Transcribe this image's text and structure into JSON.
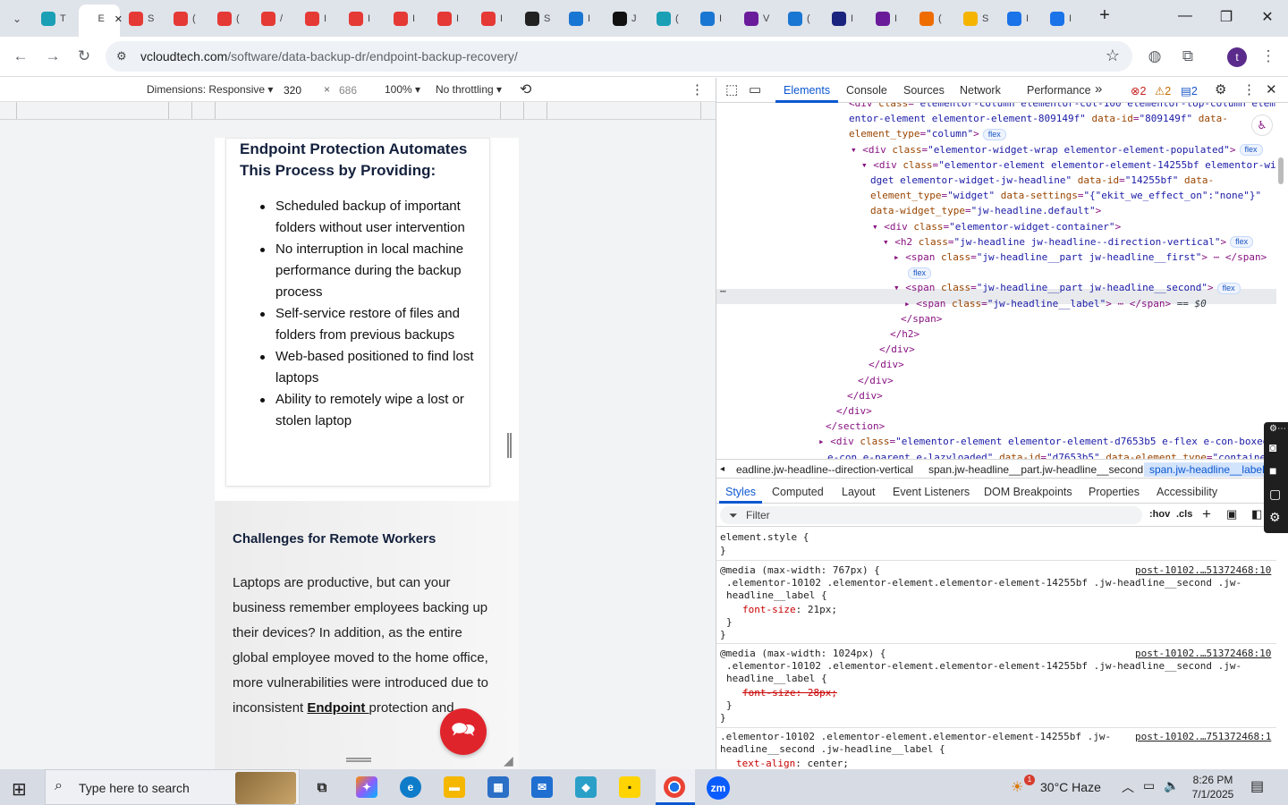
{
  "browser": {
    "tabs": [
      {
        "icon": "tab-favicon-teal",
        "label": "T"
      },
      {
        "icon": "tab-favicon-active",
        "label": "E"
      },
      {
        "icon": "tab-favicon-red",
        "label": "S"
      },
      {
        "icon": "tab-favicon-red",
        "label": "("
      },
      {
        "icon": "tab-favicon-red",
        "label": "("
      },
      {
        "icon": "tab-favicon-red",
        "label": "/"
      },
      {
        "icon": "tab-favicon-red",
        "label": "I"
      },
      {
        "icon": "tab-favicon-red",
        "label": "I"
      },
      {
        "icon": "tab-favicon-red",
        "label": "I"
      },
      {
        "icon": "tab-favicon-red",
        "label": "I"
      },
      {
        "icon": "tab-favicon-red",
        "label": "I"
      },
      {
        "icon": "tab-favicon-dark",
        "label": "S"
      },
      {
        "icon": "tab-favicon-blue",
        "label": "I"
      },
      {
        "icon": "tab-favicon-black",
        "label": "J"
      },
      {
        "icon": "tab-favicon-teal",
        "label": "("
      },
      {
        "icon": "tab-favicon-blue",
        "label": "I"
      },
      {
        "icon": "tab-favicon-purple",
        "label": "V"
      },
      {
        "icon": "tab-favicon-blue",
        "label": "("
      },
      {
        "icon": "tab-favicon-navy",
        "label": "I"
      },
      {
        "icon": "tab-favicon-purple",
        "label": "I"
      },
      {
        "icon": "tab-favicon-orange",
        "label": "("
      },
      {
        "icon": "tab-favicon-multicolor",
        "label": "S"
      },
      {
        "icon": "tab-favicon-docs",
        "label": "I"
      },
      {
        "icon": "tab-favicon-docs",
        "label": "I"
      }
    ],
    "active_tab_label": "E",
    "new_tab": "+",
    "url_host": "vcloudtech.com",
    "url_path": "/software/data-backup-dr/endpoint-backup-recovery/",
    "profile_initial": "t"
  },
  "device_toolbar": {
    "dimensions_label": "Dimensions: Responsive",
    "width": "320",
    "times": "×",
    "height": "686",
    "zoom": "100%",
    "throttling": "No throttling"
  },
  "page": {
    "card_heading": "Endpoint Protection Automates This Process by Providing:",
    "bullets": [
      "Scheduled backup of important folders without user intervention",
      "No interruption in local machine performance during the backup process",
      "Self-service restore of files and folders from previous backups",
      "Web-based positioned to find lost laptops",
      "Ability to remotely wipe a lost or stolen laptop"
    ],
    "section_title": "Challenges for Remote Workers",
    "body_before_link": "Laptops are productive, but can your business remember employees backing up their devices? In addition, as the entire global employee moved to the home office, more vulnerabilities were introduced due to inconsistent ",
    "body_link": "Endpoint ",
    "body_after_link": "protection and"
  },
  "devtools": {
    "tabs": [
      "Elements",
      "Console",
      "Sources",
      "Network",
      "Performance"
    ],
    "more_tabs": "»",
    "errors": "2",
    "warnings": "2",
    "messages": "2",
    "dom_lines": [
      {
        "indent": 148,
        "html": "<span class='tg'>&lt;div</span> <span class='at'>class</span>=<span class='av'>\"elementor-column elementor-col-100 elementor-top-column elem</span>"
      },
      {
        "indent": 148,
        "html": "<span class='av'>entor-element elementor-element-809149f\"</span> <span class='at'>data-id</span>=<span class='av'>\"809149f\"</span> <span class='at'>data-</span>"
      },
      {
        "indent": 148,
        "html": "<span class='at'>element_type</span>=<span class='av'>\"column\"</span><span class='tg'>&gt;</span>"
      },
      {
        "indent": 150,
        "html": "▾ <span class='tg'>&lt;div</span> <span class='at'>class</span>=<span class='av'>\"elementor-widget-wrap elementor-element-populated\"</span><span class='tg'>&gt;</span>"
      },
      {
        "indent": 162,
        "html": "▾ <span class='tg'>&lt;div</span> <span class='at'>class</span>=<span class='av'>\"elementor-element elementor-element-14255bf elementor-wi</span>"
      },
      {
        "indent": 172,
        "html": "<span class='av'>dget elementor-widget-jw-headline\"</span> <span class='at'>data-id</span>=<span class='av'>\"14255bf\"</span> <span class='at'>data-</span>"
      },
      {
        "indent": 172,
        "html": "<span class='at'>element_type</span>=<span class='av'>\"widget\"</span> <span class='at'>data-settings</span>=<span class='av'>\"{\"ekit_we_effect_on\":\"none\"}\"</span>"
      },
      {
        "indent": 172,
        "html": "<span class='at'>data-widget_type</span>=<span class='av'>\"jw-headline.default\"</span><span class='tg'>&gt;</span>"
      },
      {
        "indent": 174,
        "html": "▾ <span class='tg'>&lt;div</span> <span class='at'>class</span>=<span class='av'>\"elementor-widget-container\"</span><span class='tg'>&gt;</span>"
      },
      {
        "indent": 186,
        "html": "▾ <span class='tg'>&lt;h2</span> <span class='at'>class</span>=<span class='av'>\"jw-headline jw-headline--direction-vertical\"</span><span class='tg'>&gt;</span>"
      },
      {
        "indent": 198,
        "html": "▸ <span class='tg'>&lt;span</span> <span class='at'>class</span>=<span class='av'>\"jw-headline__part jw-headline__first\"</span><span class='tg'>&gt;</span> ⋯ <span class='tg'>&lt;/span&gt;</span>"
      },
      {
        "indent": 210,
        "html": ""
      },
      {
        "indent": 198,
        "html": "▾ <span class='tg'>&lt;span</span> <span class='at'>class</span>=<span class='av'>\"jw-headline__part jw-headline__second\"</span><span class='tg'>&gt;</span>"
      },
      {
        "indent": 210,
        "html": "▸ <span class='tg'>&lt;span</span> <span class='at'>class</span>=<span class='av'>\"jw-headline__label\"</span><span class='tg'>&gt;</span> ⋯ <span class='tg'>&lt;/span&gt;</span> <span class='tx'><i>== $0</i></span>"
      },
      {
        "indent": 206,
        "html": "<span class='tg'>&lt;/span&gt;</span>"
      },
      {
        "indent": 194,
        "html": "<span class='tg'>&lt;/h2&gt;</span>"
      },
      {
        "indent": 182,
        "html": "<span class='tg'>&lt;/div&gt;</span>"
      },
      {
        "indent": 170,
        "html": "<span class='tg'>&lt;/div&gt;</span>"
      },
      {
        "indent": 158,
        "html": "<span class='tg'>&lt;/div&gt;</span>"
      },
      {
        "indent": 146,
        "html": "<span class='tg'>&lt;/div&gt;</span>"
      },
      {
        "indent": 134,
        "html": "<span class='tg'>&lt;/div&gt;</span>"
      },
      {
        "indent": 122,
        "html": "<span class='tg'>&lt;/section&gt;</span>"
      },
      {
        "indent": 114,
        "html": "▸ <span class='tg'>&lt;div</span> <span class='at'>class</span>=<span class='av'>\"elementor-element elementor-element-d7653b5 e-flex e-con-boxed</span>"
      },
      {
        "indent": 124,
        "html": "<span class='av'>e-con e-parent e-lazyloaded\"</span> <span class='at'>data-id</span>=<span class='av'>\"d7653b5\"</span> <span class='at'>data-element_type</span>=<span class='av'>\"containe</span>"
      }
    ],
    "flex_badge": "flex",
    "ellipsis": "⋯",
    "breadcrumbs": [
      "eadline.jw-headline--direction-vertical",
      "span.jw-headline__part.jw-headline__second",
      "span.jw-headline__label"
    ],
    "style_tabs": [
      "Styles",
      "Computed",
      "Layout",
      "Event Listeners",
      "DOM Breakpoints",
      "Properties",
      "Accessibility"
    ],
    "filter_placeholder": "Filter",
    "hov": ":hov",
    "cls": ".cls",
    "css": {
      "element_style": "element.style {",
      "close": "}",
      "r1_media": "@media (max-width: 767px) {",
      "r1_src": "post-10102.…51372468:10",
      "r1_sel1": ".elementor-10102 .elementor-element.elementor-element-14255bf .jw-headline__second .jw-",
      "r1_sel2": "headline__label {",
      "r1_prop": "font-size",
      "r1_val": ": 21px;",
      "r2_media": "@media (max-width: 1024px) {",
      "r2_src": "post-10102.…51372468:10",
      "r2_sel1": ".elementor-10102 .elementor-element.elementor-element-14255bf .jw-headline__second .jw-",
      "r2_sel2": "headline__label {",
      "r2_struck": "font-size: 28px;",
      "r3_sel1": ".elementor-10102 .elementor-element.elementor-element-14255bf .jw-",
      "r3_src": "post-10102.…751372468:1",
      "r3_sel2": "headline__second .jw-headline__label {",
      "r3_prop": "text-align",
      "r3_val": ": center;"
    }
  },
  "taskbar": {
    "search_placeholder": "Type here to search",
    "weather": "30°C  Haze",
    "weather_badge": "1",
    "time": "8:26 PM",
    "date": "7/1/2025"
  },
  "colors": {
    "accent": "#0b57d0",
    "chat": "#e0242c",
    "heading": "#14213d"
  }
}
